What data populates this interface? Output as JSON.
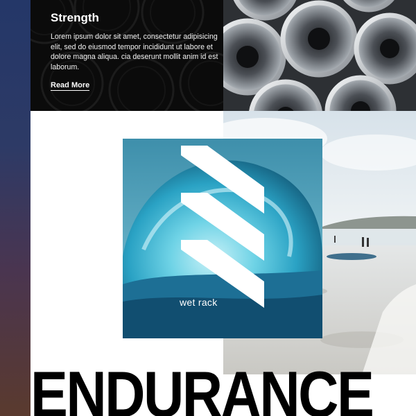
{
  "strength": {
    "title": "Strength",
    "body": "Lorem ipsum dolor sit amet, consectetur adipisicing elit, sed do eiusmod tempor incididunt ut labore et dolore magna aliqua. cia deserunt mollit anim id est laborum.",
    "read_more": "Read More"
  },
  "logo": {
    "brand_name": "wet rack",
    "icon": "three-stripes-logo-icon"
  },
  "headline": "ENDURANCE",
  "images": {
    "pipes": "steel-pipes-photo",
    "beach": "beach-photo",
    "wave": "ocean-wave-photo"
  },
  "colors": {
    "side_gradient_top": "#243768",
    "side_gradient_bottom": "#5a3a2e",
    "panel_bg": "#0b0b0b",
    "wave_teal": "#2fb3d2",
    "headline": "#000000"
  }
}
